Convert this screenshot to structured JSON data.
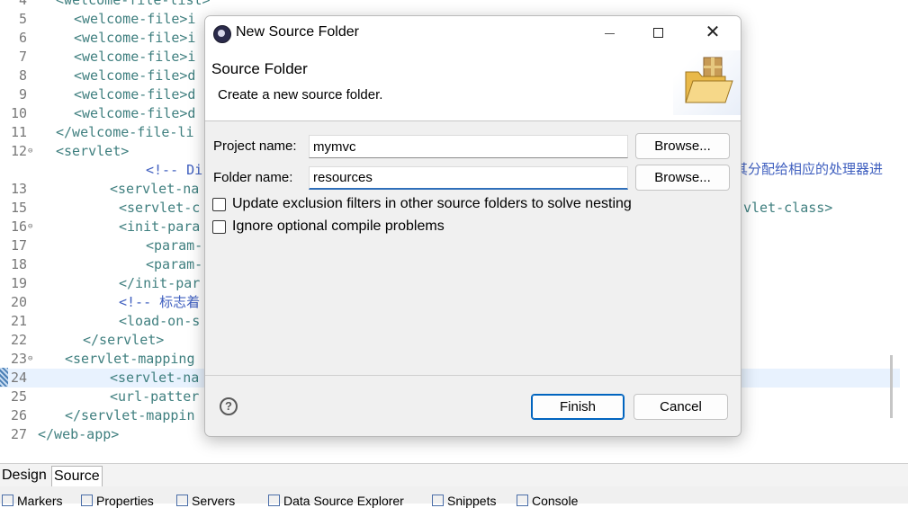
{
  "editor": {
    "lines": [
      {
        "n": "4",
        "fold": "",
        "text": "<welcome-file-list>",
        "indent": "  ",
        "comment": false
      },
      {
        "n": "5",
        "fold": "",
        "text": "<welcome-file>i",
        "indent": "    ",
        "comment": false
      },
      {
        "n": "6",
        "fold": "",
        "text": "<welcome-file>i",
        "indent": "    ",
        "comment": false
      },
      {
        "n": "7",
        "fold": "",
        "text": "<welcome-file>i",
        "indent": "    ",
        "comment": false
      },
      {
        "n": "8",
        "fold": "",
        "text": "<welcome-file>d",
        "indent": "    ",
        "comment": false
      },
      {
        "n": "9",
        "fold": "",
        "text": "<welcome-file>d",
        "indent": "    ",
        "comment": false
      },
      {
        "n": "10",
        "fold": "",
        "text": "<welcome-file>d",
        "indent": "    ",
        "comment": false
      },
      {
        "n": "11",
        "fold": "",
        "text": "</welcome-file-li",
        "indent": "  ",
        "comment": false
      },
      {
        "n": "12",
        "fold": "⊖",
        "text": "<servlet>",
        "indent": "  ",
        "comment": false
      },
      {
        "n": "",
        "fold": "",
        "text": "<!-- Di",
        "indent": "            ",
        "comment": true
      },
      {
        "n": "13",
        "fold": "",
        "text": "<servlet-na",
        "indent": "        ",
        "comment": false
      },
      {
        "n": "15",
        "fold": "",
        "text": "<servlet-c",
        "indent": "         ",
        "comment": false
      },
      {
        "n": "16",
        "fold": "⊖",
        "text": "<init-para",
        "indent": "         ",
        "comment": false
      },
      {
        "n": "17",
        "fold": "",
        "text": "<param-",
        "indent": "            ",
        "comment": false
      },
      {
        "n": "18",
        "fold": "",
        "text": "<param-",
        "indent": "            ",
        "comment": false
      },
      {
        "n": "19",
        "fold": "",
        "text": "</init-par",
        "indent": "         ",
        "comment": false
      },
      {
        "n": "20",
        "fold": "",
        "text": "<!-- 标志着",
        "indent": "         ",
        "comment": true
      },
      {
        "n": "21",
        "fold": "",
        "text": "<load-on-s",
        "indent": "         ",
        "comment": false
      },
      {
        "n": "22",
        "fold": "",
        "text": "</servlet>",
        "indent": "     ",
        "comment": false
      },
      {
        "n": "23",
        "fold": "⊖",
        "text": "<servlet-mapping",
        "indent": "   ",
        "comment": false
      },
      {
        "n": "24",
        "fold": "",
        "text": "<servlet-na",
        "indent": "        ",
        "comment": false
      },
      {
        "n": "25",
        "fold": "",
        "text": "<url-patter",
        "indent": "        ",
        "comment": false
      },
      {
        "n": "26",
        "fold": "",
        "text": "</servlet-mappin",
        "indent": "   ",
        "comment": false
      },
      {
        "n": "27",
        "fold": "",
        "text": "</web-app>",
        "indent": "",
        "comment": false
      }
    ],
    "right_comment": "其分配给相应的处理器进",
    "right_tag": "vlet-class>"
  },
  "bottom_tabs": {
    "design": "Design",
    "source": "Source"
  },
  "views": [
    {
      "label": "Markers"
    },
    {
      "label": "Properties"
    },
    {
      "label": "Servers"
    },
    {
      "label": "Data Source Explorer"
    },
    {
      "label": "Snippets"
    },
    {
      "label": "Console"
    }
  ],
  "dialog": {
    "title": "New Source Folder",
    "header_title": "Source Folder",
    "header_desc": "Create a new source folder.",
    "project_label": "Project name:",
    "project_value": "mymvc",
    "folder_label": "Folder name:",
    "folder_value": "resources",
    "browse_label": "Browse...",
    "chk1_label": "Update exclusion filters in other source folders to solve nesting",
    "chk1_checked": false,
    "chk2_label": "Ignore optional compile problems",
    "chk2_checked": false,
    "help_glyph": "?",
    "finish_label": "Finish",
    "cancel_label": "Cancel",
    "close_glyph": "✕"
  }
}
